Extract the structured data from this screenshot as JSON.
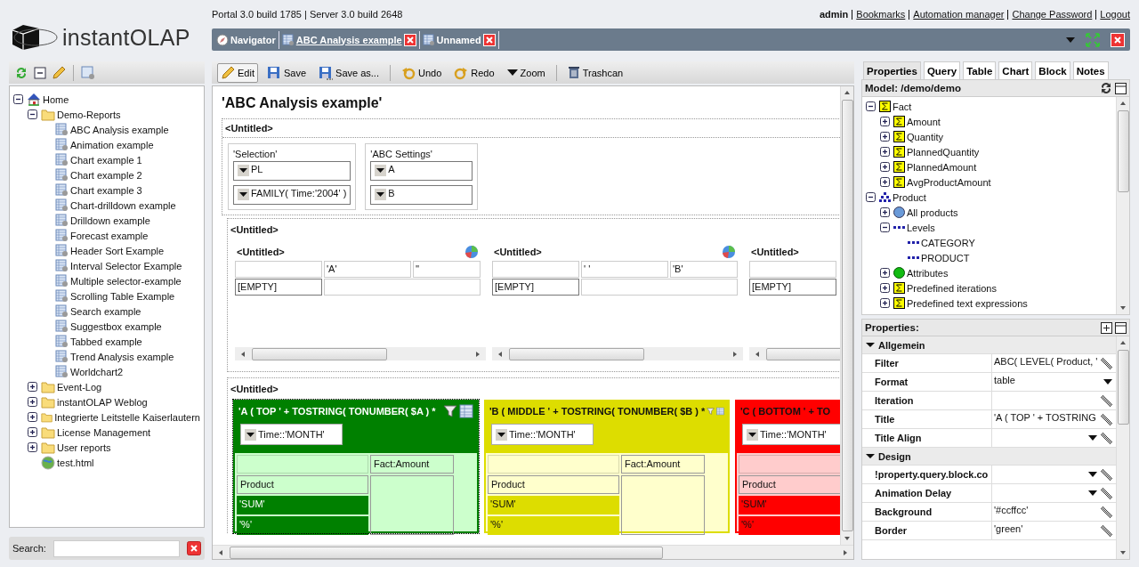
{
  "logo": {
    "text": "instantOLAP"
  },
  "header": {
    "build": "Portal 3.0 build 1785 | Server 3.0 build 2648",
    "user": "admin",
    "links": [
      "Bookmarks",
      "Automation manager",
      "Change Password",
      "Logout"
    ]
  },
  "doc_tabs": [
    {
      "label": "Navigator",
      "kind": "navigator",
      "selected": false
    },
    {
      "label": "ABC Analysis example",
      "kind": "report",
      "selected": true
    },
    {
      "label": "Unnamed",
      "kind": "report",
      "selected": false
    }
  ],
  "nav_tree": {
    "items": [
      {
        "label": "Home",
        "kind": "home",
        "expanded": true,
        "children": [
          {
            "label": "Demo-Reports",
            "kind": "folder",
            "expanded": true,
            "children": [
              {
                "label": "ABC Analysis example",
                "kind": "report"
              },
              {
                "label": "Animation example",
                "kind": "report"
              },
              {
                "label": "Chart example 1",
                "kind": "report"
              },
              {
                "label": "Chart example 2",
                "kind": "report"
              },
              {
                "label": "Chart example 3",
                "kind": "report"
              },
              {
                "label": "Chart-drilldown example",
                "kind": "report"
              },
              {
                "label": "Drilldown example",
                "kind": "report"
              },
              {
                "label": "Forecast example",
                "kind": "report"
              },
              {
                "label": "Header Sort Example",
                "kind": "report"
              },
              {
                "label": "Interval Selector Example",
                "kind": "report"
              },
              {
                "label": "Multiple selector-example",
                "kind": "report"
              },
              {
                "label": "Scrolling Table Example",
                "kind": "report"
              },
              {
                "label": "Search example",
                "kind": "report"
              },
              {
                "label": "Suggestbox example",
                "kind": "report"
              },
              {
                "label": "Tabbed example",
                "kind": "report"
              },
              {
                "label": "Trend Analysis example",
                "kind": "report"
              },
              {
                "label": "Worldchart2",
                "kind": "report"
              }
            ]
          },
          {
            "label": "Event-Log",
            "kind": "folder",
            "expanded": false
          },
          {
            "label": "instantOLAP Weblog",
            "kind": "folder",
            "expanded": false
          },
          {
            "label": "Integrierte Leitstelle Kaiserlautern",
            "kind": "folder",
            "expanded": false
          },
          {
            "label": "License Management",
            "kind": "folder",
            "expanded": false
          },
          {
            "label": "User reports",
            "kind": "folder",
            "expanded": false
          },
          {
            "label": "test.html",
            "kind": "web"
          }
        ]
      }
    ]
  },
  "search": {
    "label": "Search:"
  },
  "toolbar": [
    [
      {
        "label": "Edit",
        "kind": "edit",
        "selected": true
      },
      {
        "label": "Save",
        "kind": "save",
        "selected": false
      },
      {
        "label": "Save as...",
        "kind": "save_as",
        "selected": false
      }
    ],
    [
      {
        "label": "Undo",
        "kind": "undo",
        "selected": false
      },
      {
        "label": "Redo",
        "kind": "redo",
        "selected": false
      },
      {
        "label": "Zoom",
        "kind": "zoom",
        "selected": false
      }
    ],
    [
      {
        "label": "Trashcan",
        "kind": "trash",
        "selected": false
      }
    ]
  ],
  "report": {
    "title": "'ABC Analysis example'"
  },
  "selection_section": {
    "title": "<Untitled>",
    "panels": [
      {
        "title": "'Selection'",
        "selectors": [
          "PL",
          "FAMILY( Time:'2004' )"
        ]
      },
      {
        "title": "'ABC Settings'",
        "selectors": [
          "A",
          "B"
        ]
      }
    ]
  },
  "tables_section": {
    "title": "<Untitled>",
    "tables": [
      {
        "title": "<Untitled>",
        "columns": [
          "'A'",
          "''"
        ],
        "row_label": "[EMPTY]"
      },
      {
        "title": "<Untitled>",
        "columns": [
          "' '",
          "'B'"
        ],
        "row_label": "[EMPTY]"
      },
      {
        "title": "<Untitled>",
        "row_label": "[EMPTY]"
      }
    ]
  },
  "abc_section": {
    "title": "<Untitled>",
    "blocks": [
      {
        "title": "'A ( TOP ' + TOSTRING( TONUMBER( $A ) *",
        "color": "#008000",
        "light_text": true,
        "selected": true,
        "selector": "Time::'MONTH'",
        "column_header": "Fact:Amount",
        "row_header": "Product",
        "rows": [
          "'SUM'",
          "'%'"
        ]
      },
      {
        "title": "'B ( MIDDLE ' + TOSTRING( TONUMBER( $B ) *",
        "color": "#dddd00",
        "light_text": false,
        "selected": false,
        "selector": "Time::'MONTH'",
        "column_header": "Fact:Amount",
        "row_header": "Product",
        "rows": [
          "'SUM'",
          "'%'"
        ]
      },
      {
        "title": "'C ( BOTTOM ' + TO",
        "color": "#ff0000",
        "light_text": false,
        "selected": false,
        "selector": "Time::'MONTH'",
        "row_header": "Product",
        "rows": [
          "'SUM'",
          "'%'"
        ]
      }
    ]
  },
  "side_tabs": [
    {
      "label": "Properties",
      "selected": true
    },
    {
      "label": "Query",
      "selected": false
    },
    {
      "label": "Table",
      "selected": false
    },
    {
      "label": "Chart",
      "selected": false
    },
    {
      "label": "Block",
      "selected": false
    },
    {
      "label": "Notes",
      "selected": false
    }
  ],
  "model": {
    "label": "Model: /demo/demo",
    "tree": [
      {
        "label": "Fact",
        "kind": "measure",
        "expanded": true,
        "children": [
          {
            "label": "Amount",
            "kind": "measure",
            "expanded": false
          },
          {
            "label": "Quantity",
            "kind": "measure",
            "expanded": false
          },
          {
            "label": "PlannedQuantity",
            "kind": "measure",
            "expanded": false
          },
          {
            "label": "PlannedAmount",
            "kind": "measure",
            "expanded": false
          },
          {
            "label": "AvgProductAmount",
            "kind": "measure",
            "expanded": false
          }
        ]
      },
      {
        "label": "Product",
        "kind": "dimension",
        "expanded": true,
        "children": [
          {
            "label": "All products",
            "kind": "member",
            "expanded": false
          },
          {
            "label": "Levels",
            "kind": "level",
            "expanded": true,
            "children": [
              {
                "label": "CATEGORY",
                "kind": "level"
              },
              {
                "label": "PRODUCT",
                "kind": "level"
              }
            ]
          },
          {
            "label": "Attributes",
            "kind": "attribute",
            "expanded": false
          },
          {
            "label": "Predefined iterations",
            "kind": "measure",
            "expanded": false
          },
          {
            "label": "Predefined text expressions",
            "kind": "measure",
            "expanded": false
          }
        ]
      }
    ]
  },
  "properties": {
    "label": "Properties:",
    "groups": [
      {
        "label": "Allgemein",
        "expanded": true,
        "rows": [
          {
            "name": "Filter",
            "value": "ABC( LEVEL( Product, '",
            "dropdown": false,
            "editable": true
          },
          {
            "name": "Format",
            "value": "table",
            "dropdown": true,
            "editable": false
          },
          {
            "name": "Iteration",
            "dropdown": false,
            "editable": true
          },
          {
            "name": "Title",
            "value": "'A ( TOP ' + TOSTRING",
            "dropdown": false,
            "editable": true
          },
          {
            "name": "Title Align",
            "dropdown": true,
            "editable": true
          }
        ]
      },
      {
        "label": "Design",
        "expanded": true,
        "rows": [
          {
            "name": "!property.query.block.co",
            "dropdown": true,
            "editable": true
          },
          {
            "name": "Animation Delay",
            "dropdown": true,
            "editable": true
          },
          {
            "name": "Background",
            "value": "'#ccffcc'",
            "dropdown": false,
            "editable": true
          },
          {
            "name": "Border",
            "value": "'green'",
            "dropdown": false,
            "editable": true
          }
        ]
      }
    ]
  }
}
